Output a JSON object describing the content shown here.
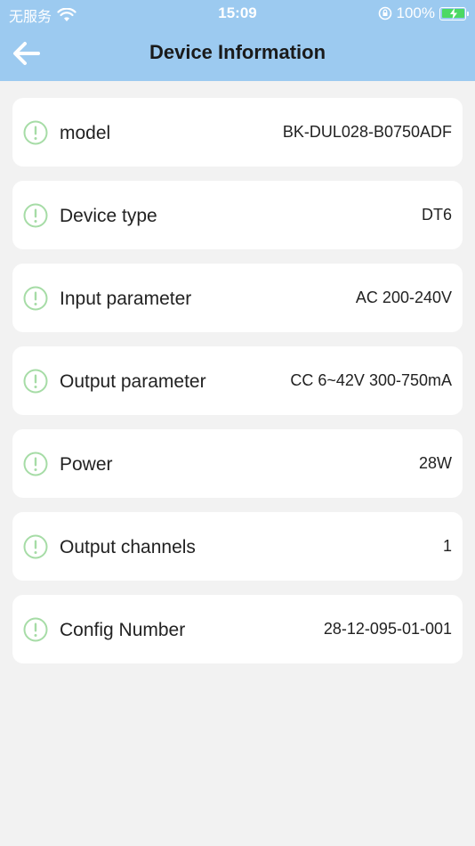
{
  "status_bar": {
    "carrier": "无服务",
    "time": "15:09",
    "battery_percent": "100%"
  },
  "header": {
    "title": "Device Information",
    "back_icon": "arrow-left-icon"
  },
  "colors": {
    "header_bg": "#9ccaf0",
    "icon_green": "#a6dca6",
    "page_bg": "#f2f2f2"
  },
  "items": [
    {
      "label": "model",
      "value": "BK-DUL028-B0750ADF",
      "icon": "info-circle-icon"
    },
    {
      "label": "Device type",
      "value": "DT6",
      "icon": "info-circle-icon"
    },
    {
      "label": "Input parameter",
      "value": "AC 200-240V",
      "icon": "info-circle-icon"
    },
    {
      "label": "Output parameter",
      "value": "CC 6~42V 300-750mA",
      "icon": "info-circle-icon"
    },
    {
      "label": "Power",
      "value": "28W",
      "icon": "info-circle-icon"
    },
    {
      "label": "Output channels",
      "value": "1",
      "icon": "info-circle-icon"
    },
    {
      "label": "Config Number",
      "value": "28-12-095-01-001",
      "icon": "info-circle-icon"
    }
  ]
}
